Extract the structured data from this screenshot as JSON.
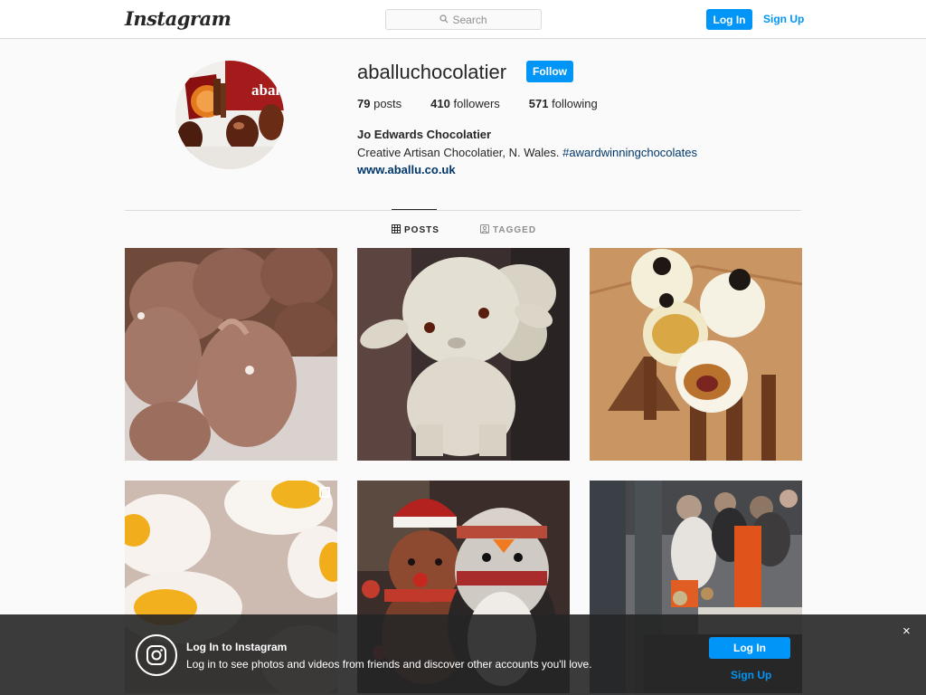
{
  "nav": {
    "logo": "Instagram",
    "search_placeholder": "Search",
    "login_label": "Log In",
    "signup_label": "Sign Up"
  },
  "profile": {
    "username": "aballuchocolatier",
    "follow_label": "Follow",
    "posts_count": "79",
    "posts_label": "posts",
    "followers_count": "410",
    "followers_label": "followers",
    "following_count": "571",
    "following_label": "following",
    "full_name": "Jo Edwards Chocolatier",
    "bio_text": "Creative Artisan Chocolatier, N. Wales.",
    "bio_hashtag": "#awardwinningchocolates",
    "website": "www.aballu.co.uk",
    "avatar_text": "aball"
  },
  "tabs": {
    "posts": "POSTS",
    "tagged": "TAGGED"
  },
  "posts": [
    {
      "name": "chocolate-bunnies"
    },
    {
      "name": "white-chocolate-lamb"
    },
    {
      "name": "white-chocolate-truffles"
    },
    {
      "name": "egg-shaped-candies"
    },
    {
      "name": "christmas-plush-toys"
    },
    {
      "name": "market-stall-crowd"
    }
  ],
  "banner": {
    "title": "Log In to Instagram",
    "text": "Log in to see photos and videos from friends and discover other accounts you'll love.",
    "login_label": "Log In",
    "signup_label": "Sign Up",
    "close": "×"
  },
  "colors": {
    "accent": "#0095f6",
    "link": "#00376b",
    "background": "#fafafa"
  },
  "icons": [
    "search-icon",
    "grid-icon",
    "tag-icon",
    "instagram-icon",
    "close-icon",
    "multiple-photos-icon"
  ]
}
